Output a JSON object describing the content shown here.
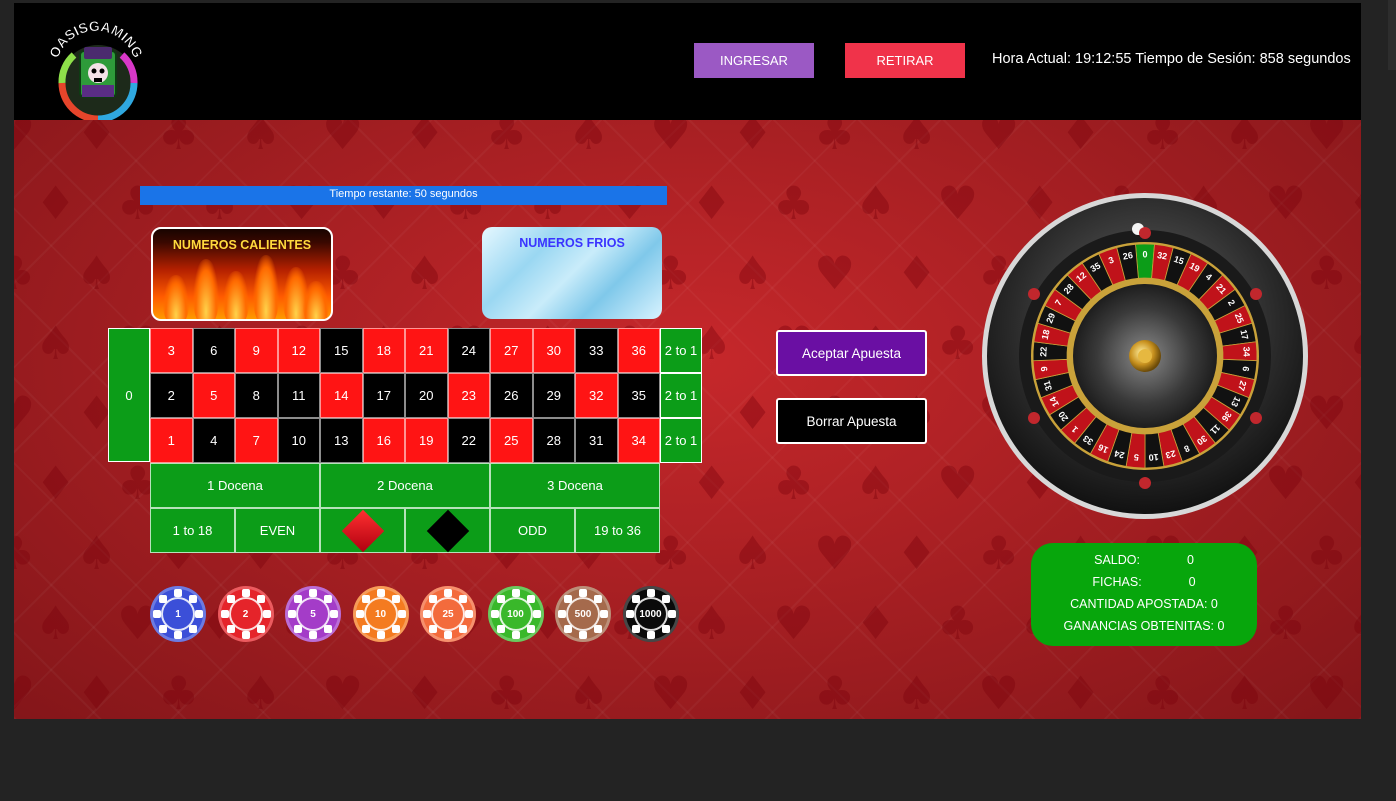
{
  "header": {
    "logo_text": "OASISGAMING",
    "ingresar_label": "INGRESAR",
    "retirar_label": "RETIRAR",
    "clock_text": "Hora Actual: 19:12:55 Tiempo de Sesión: 858 segundos"
  },
  "timer": {
    "text": "Tiempo restante: 50 segundos"
  },
  "hot_numbers": {
    "title": "NUMEROS CALIENTES"
  },
  "cold_numbers": {
    "title": "NUMEROS FRIOS"
  },
  "board": {
    "zero": "0",
    "rows": [
      [
        "3",
        "6",
        "9",
        "12",
        "15",
        "18",
        "21",
        "24",
        "27",
        "30",
        "33",
        "36"
      ],
      [
        "2",
        "5",
        "8",
        "11",
        "14",
        "17",
        "20",
        "23",
        "26",
        "29",
        "32",
        "35"
      ],
      [
        "1",
        "4",
        "7",
        "10",
        "13",
        "16",
        "19",
        "22",
        "25",
        "28",
        "31",
        "34"
      ]
    ],
    "colors": [
      [
        "red",
        "black",
        "red",
        "red",
        "black",
        "red",
        "red",
        "black",
        "red",
        "red",
        "black",
        "red"
      ],
      [
        "black",
        "red",
        "black",
        "black",
        "red",
        "black",
        "black",
        "red",
        "black",
        "black",
        "red",
        "black"
      ],
      [
        "red",
        "black",
        "red",
        "black",
        "black",
        "red",
        "red",
        "black",
        "red",
        "black",
        "black",
        "red"
      ]
    ],
    "column_bets": [
      "2 to 1",
      "2 to 1",
      "2 to 1"
    ],
    "dozens": [
      "1 Docena",
      "2 Docena",
      "3 Docena"
    ],
    "outside": {
      "low": "1 to 18",
      "even": "EVEN",
      "odd": "ODD",
      "high": "19 to 36"
    },
    "red_color": "#ff1414",
    "green_color": "#0c9d18"
  },
  "chips": [
    {
      "value": "1",
      "color": "#3b4fd8"
    },
    {
      "value": "2",
      "color": "#e5242a"
    },
    {
      "value": "5",
      "color": "#a43cc8"
    },
    {
      "value": "10",
      "color": "#f47b20"
    },
    {
      "value": "25",
      "color": "#f36b3c"
    },
    {
      "value": "100",
      "color": "#39b82a"
    },
    {
      "value": "500",
      "color": "#a56a4c"
    },
    {
      "value": "1000",
      "color": "#0a0a0a"
    }
  ],
  "actions": {
    "accept_label": "Aceptar Apuesta",
    "clear_label": "Borrar Apuesta"
  },
  "wheel": {
    "numbers": [
      "0",
      "32",
      "15",
      "19",
      "4",
      "21",
      "2",
      "25",
      "17",
      "34",
      "6",
      "27",
      "13",
      "36",
      "11",
      "30",
      "8",
      "23",
      "10",
      "5",
      "24",
      "16",
      "33",
      "1",
      "20",
      "14",
      "31",
      "9",
      "22",
      "18",
      "29",
      "7",
      "28",
      "12",
      "35",
      "3",
      "26"
    ]
  },
  "stats": {
    "saldo_label": "SALDO:",
    "saldo_value": "0",
    "fichas_label": "FICHAS:",
    "fichas_value": "0",
    "apostada_label": "CANTIDAD APOSTADA:",
    "apostada_value": "0",
    "ganancias_label": "GANANCIAS OBTENITAS:",
    "ganancias_value": "0"
  }
}
